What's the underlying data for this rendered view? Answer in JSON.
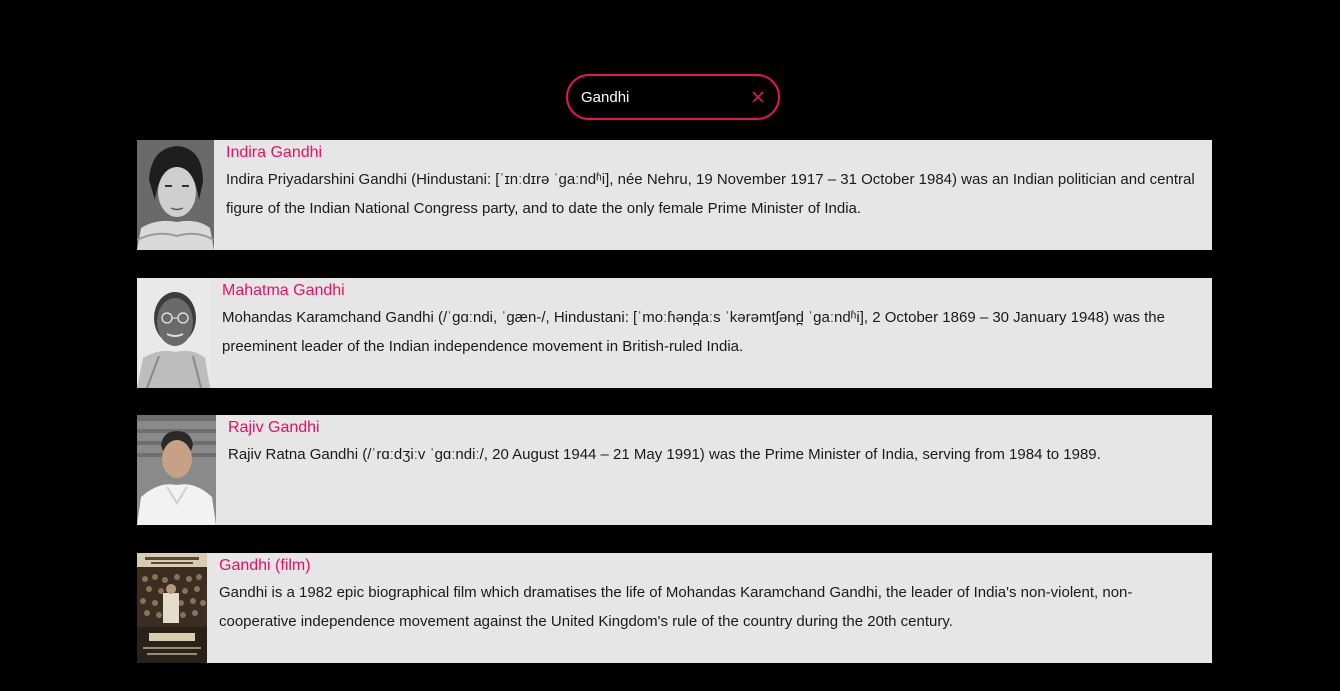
{
  "search": {
    "value": "Gandhi",
    "clear_icon": "close-icon"
  },
  "colors": {
    "accent": "#e8105f",
    "background": "#000000",
    "card": "#e6e6e6",
    "text": "#1a1a1a"
  },
  "results": [
    {
      "title": "Indira Gandhi",
      "text": "Indira Priyadarshini Gandhi (Hindustani: [ˈɪnːdɪrə ˈɡaːndʱi], née Nehru, 19 November 1917 – 31 October 1984) was an Indian politician and central figure of the Indian National Congress party, and to date the only female Prime Minister of India."
    },
    {
      "title": "Mahatma Gandhi",
      "text": "Mohandas Karamchand Gandhi (/ˈɡɑːndi, ˈɡæn-/, Hindustani: [ˈmoːɦənd̪aːs ˈkərəmtʃənd̪ ˈɡaːndʱi], 2 October 1869 – 30 January 1948) was the preeminent leader of the Indian independence movement in British-ruled India."
    },
    {
      "title": "Rajiv Gandhi",
      "text": "Rajiv Ratna Gandhi (/ˈrɑːdʒiːv ˈɡɑːndiː/, 20 August 1944 – 21 May 1991) was the Prime Minister of India, serving from 1984 to 1989."
    },
    {
      "title": "Gandhi (film)",
      "text": "Gandhi is a 1982 epic biographical film which dramatises the life of Mohandas Karamchand Gandhi, the leader of India's non-violent, non-cooperative independence movement against the United Kingdom's rule of the country during the 20th century."
    }
  ]
}
